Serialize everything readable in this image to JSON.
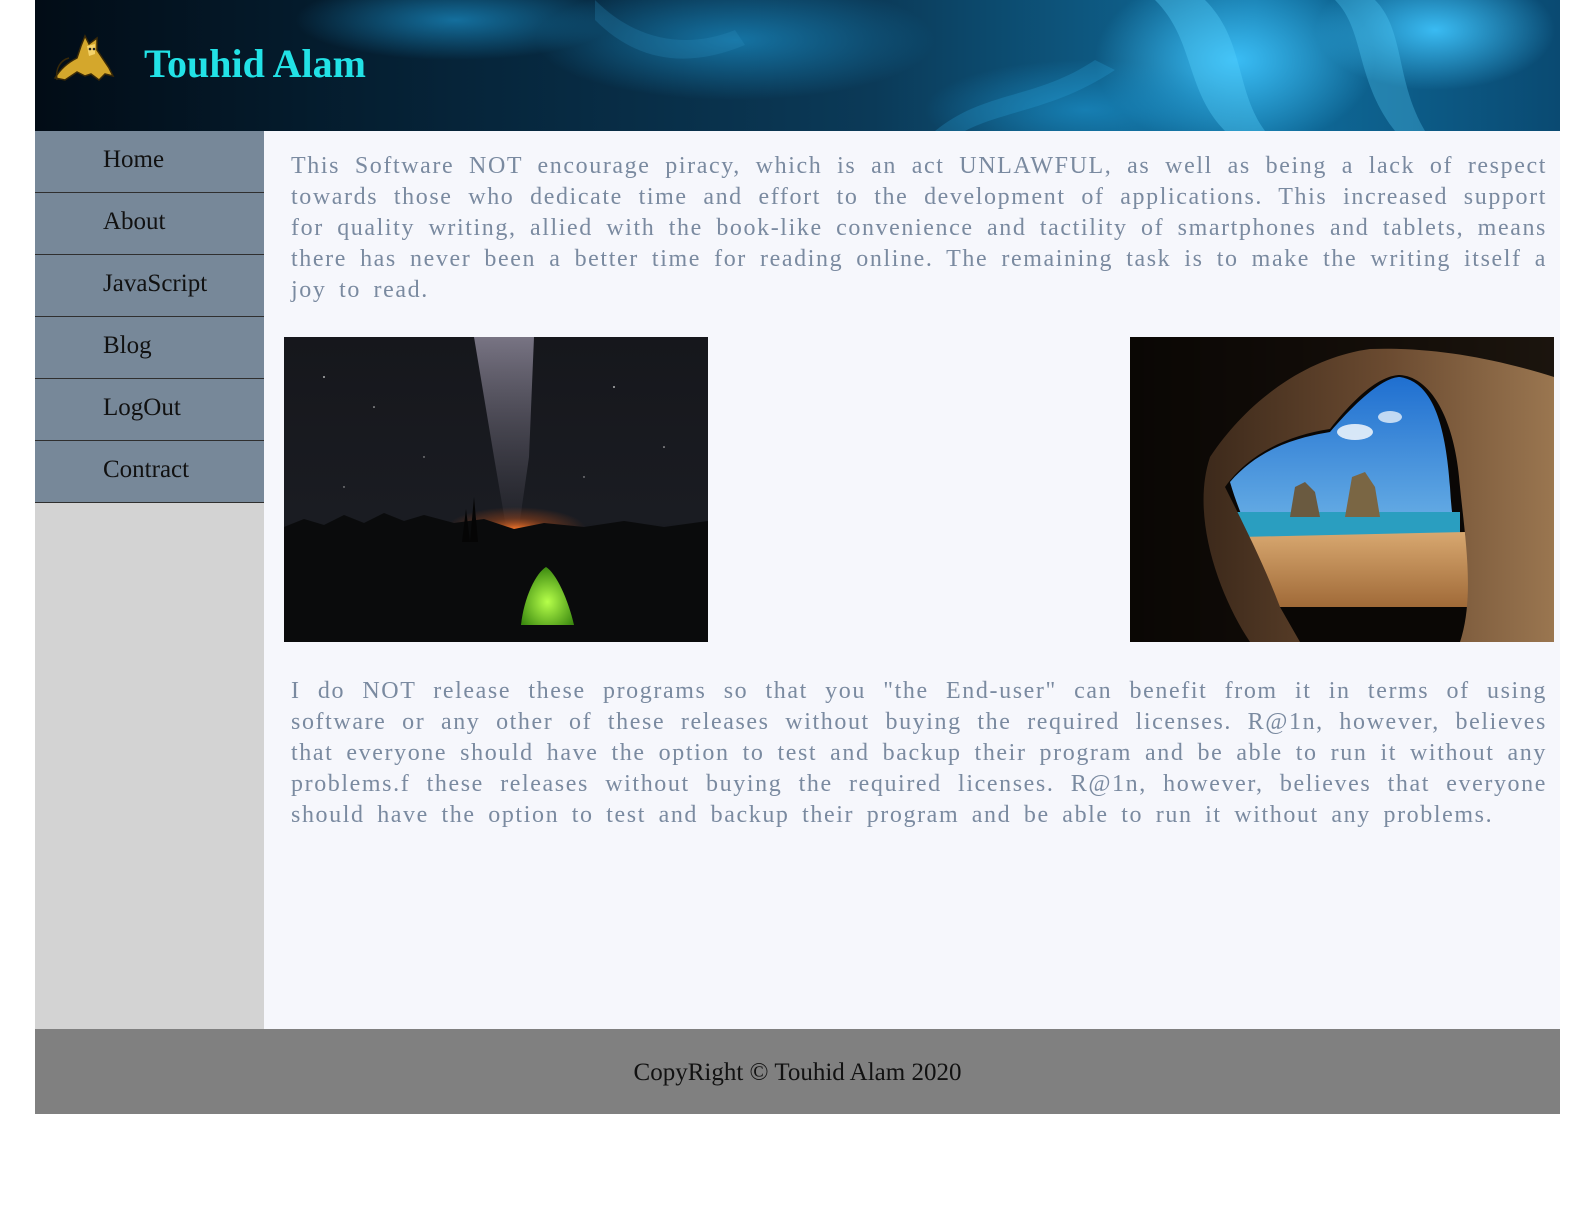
{
  "header": {
    "title": "Touhid Alam",
    "logo_icon": "tomcat-logo-icon",
    "title_color": "#22e2e6"
  },
  "sidebar": {
    "items": [
      {
        "label": "Home"
      },
      {
        "label": "About"
      },
      {
        "label": "JavaScript"
      },
      {
        "label": "Blog"
      },
      {
        "label": "LogOut"
      },
      {
        "label": "Contract"
      }
    ],
    "item_color": "#778899",
    "background": "#d3d3d3"
  },
  "main": {
    "paragraph1": "This Software NOT encourage piracy, which is an act UNLAWFUL, as well as being a lack of respect towards those who dedicate time and effort to the development of applications. This increased support for quality writing, allied with the book-like convenience and tactility of smartphones and tablets, means there has never been a better time for reading online. The remaining task is to make the writing itself a joy to read.",
    "paragraph2": "I do NOT release these programs so that you \"the End-user\" can benefit from it in terms of using software or any other of these releases without buying the required licenses. R@1n, however, believes that everyone should have the option to test and backup their program and be able to run it without any problems.f these releases without buying the required licenses. R@1n, however, believes that everyone should have the option to test and backup their program and be able to run it without any problems.",
    "images": [
      {
        "icon": "night-sky-tent-image"
      },
      {
        "icon": "sea-cave-beach-image"
      }
    ],
    "text_color": "#7a8aa0",
    "background": "#f6f7fc"
  },
  "footer": {
    "text": "CopyRight © Touhid Alam 2020",
    "background": "#808080"
  }
}
